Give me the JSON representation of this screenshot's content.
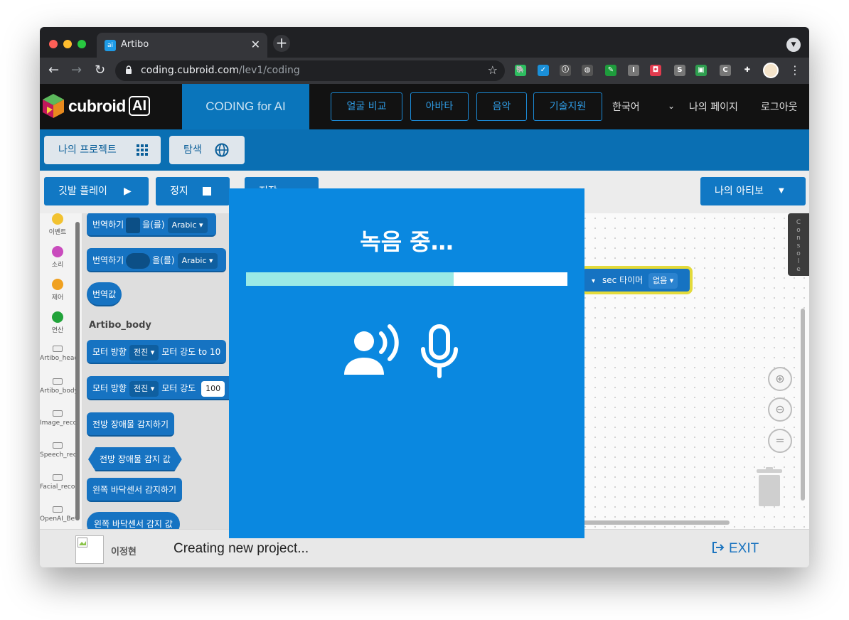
{
  "browser": {
    "tab_title": "Artibo",
    "tab_favicon_text": "ai",
    "tab_close": "✕",
    "new_tab": "+",
    "url_host": "coding.cubroid.com",
    "url_path": "/lev1/coding",
    "extensions": [
      {
        "name": "evernote-icon",
        "glyph": "🐘",
        "color": "#2dbe60"
      },
      {
        "name": "check-icon",
        "glyph": "✓",
        "color": "#1a8fd8"
      },
      {
        "name": "info-icon",
        "glyph": "ⓘ",
        "color": "#555555"
      },
      {
        "name": "globe-icon",
        "glyph": "◍",
        "color": "#555555"
      },
      {
        "name": "pin-icon",
        "glyph": "✎",
        "color": "#1e9c3c"
      },
      {
        "name": "i-icon",
        "glyph": "I",
        "color": "#777777"
      },
      {
        "name": "bot-icon",
        "glyph": "◘",
        "color": "#e23b4e"
      },
      {
        "name": "s-icon",
        "glyph": "S",
        "color": "#777777"
      },
      {
        "name": "flag-icon",
        "glyph": "▣",
        "color": "#2e9e4f"
      },
      {
        "name": "c-icon",
        "glyph": "C",
        "color": "#777777"
      },
      {
        "name": "puzzle-icon",
        "glyph": "✚",
        "color": "#35363a"
      }
    ]
  },
  "header": {
    "logo_text": "cubroid",
    "logo_badge": "AI",
    "product": "CODING for AI",
    "nav_buttons": [
      "얼굴 비교",
      "아바타",
      "음악",
      "기술지원"
    ],
    "language": "한국어",
    "my_page": "나의 페이지",
    "logout": "로그아웃"
  },
  "subbar": {
    "my_projects": "나의 프로젝트",
    "explore": "탐색"
  },
  "actions": {
    "play": "깃발 플레이",
    "stop": "정지",
    "save": "저장",
    "device": "나의 아티보"
  },
  "categories": [
    {
      "label": "이벤트",
      "color": "#f2c230",
      "kind": "dot"
    },
    {
      "label": "소리",
      "color": "#c94bbd",
      "kind": "dot"
    },
    {
      "label": "제어",
      "color": "#f0a120",
      "kind": "dot"
    },
    {
      "label": "연산",
      "color": "#21a33a",
      "kind": "dot"
    },
    {
      "label": "Artibo_head",
      "kind": "device"
    },
    {
      "label": "Artibo_body",
      "kind": "device"
    },
    {
      "label": "Image_recogn",
      "kind": "device"
    },
    {
      "label": "Speech_recog",
      "kind": "device"
    },
    {
      "label": "Facial_recogni",
      "kind": "device"
    },
    {
      "label": "OpenAI_Beta",
      "kind": "device"
    }
  ],
  "blocks": {
    "translate1_label": "번역하기",
    "translate1_suffix": "을(를)",
    "translate1_lang": "Arabic",
    "translate2_label": "번역하기",
    "translate2_suffix": "을(를)",
    "translate2_lang": "Arabic",
    "translate_value": "번역값",
    "section_heading": "Artibo_body",
    "motor1_label": "모터 방향",
    "motor1_dir": "전진",
    "motor1_power": "모터 강도 to",
    "motor1_value": "10",
    "motor2_label": "모터 방향",
    "motor2_dir": "전진",
    "motor2_power": "모터 강도",
    "motor2_value": "100",
    "front_detect": "전방 장애물 감지하기",
    "front_value": "전방 장애물 감지 값",
    "left_detect": "왼쪽 바닥센서 감지하기",
    "left_value": "왼쪽 바닥센서 감지 값"
  },
  "canvas": {
    "console_label": "Console",
    "timer_block_sec": "sec",
    "timer_block_label": "타이머",
    "timer_block_value": "없음",
    "zoom_in": "+",
    "zoom_out": "−",
    "zoom_reset": "="
  },
  "footer": {
    "user_name": "이정현",
    "status": "Creating new project...",
    "exit": "EXIT"
  },
  "modal": {
    "title": "녹음 중…",
    "progress_fraction": 0.645,
    "icons": [
      "speaking-person-icon",
      "microphone-icon"
    ]
  },
  "colors": {
    "modal_bg": "#0a88e0",
    "progress_fill": "#9aeae6",
    "header_bg": "#121212",
    "brand_blue": "#0a75bb"
  }
}
